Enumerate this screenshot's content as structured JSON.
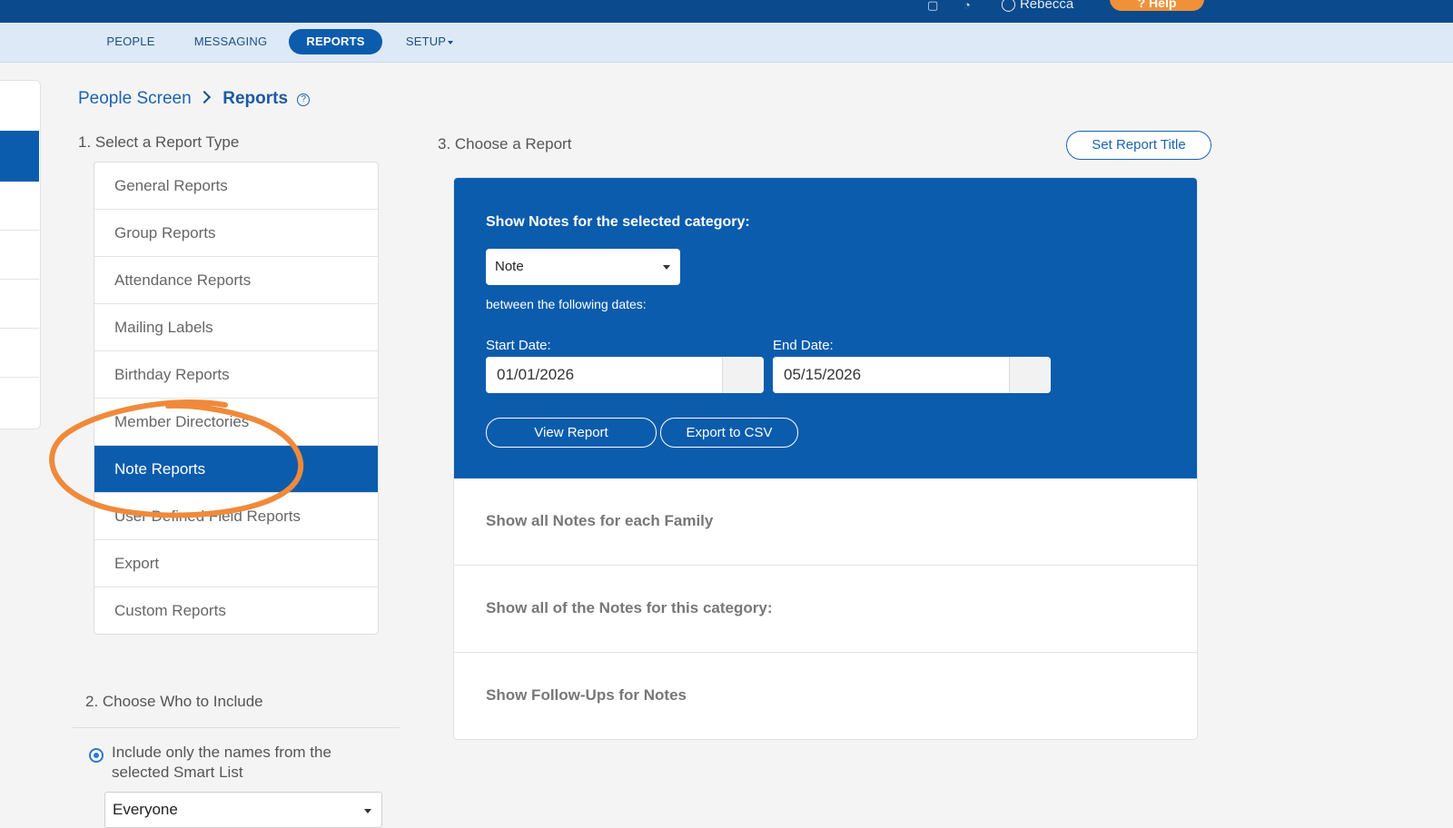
{
  "topbar": {
    "user_name": "Rebecca",
    "help_label": "Help"
  },
  "nav": {
    "items": [
      {
        "label": "PEOPLE"
      },
      {
        "label": "MESSAGING"
      },
      {
        "label": "REPORTS"
      },
      {
        "label": "SETUP"
      }
    ],
    "active": "REPORTS"
  },
  "breadcrumb": {
    "parent": "People Screen",
    "current": "Reports",
    "help": "?"
  },
  "section1": {
    "heading": "1. Select a Report Type",
    "items": [
      {
        "label": "General Reports"
      },
      {
        "label": "Group Reports"
      },
      {
        "label": "Attendance Reports"
      },
      {
        "label": "Mailing Labels"
      },
      {
        "label": "Birthday Reports"
      },
      {
        "label": "Member Directories"
      },
      {
        "label": "Note Reports"
      },
      {
        "label": "User Defined Field Reports"
      },
      {
        "label": "Export"
      },
      {
        "label": "Custom Reports"
      }
    ],
    "selected": "Note Reports"
  },
  "section3": {
    "heading": "3. Choose a Report",
    "set_title_label": "Set Report Title",
    "active_report": {
      "title": "Show Notes for the selected category:",
      "category_value": "Note",
      "between_text": "between the following dates:",
      "start_label": "Start Date:",
      "start_value": "01/01/2026",
      "end_label": "End Date:",
      "end_value": "05/15/2026",
      "view_label": "View Report",
      "export_label": "Export to CSV"
    },
    "options": [
      {
        "label": "Show all Notes for each Family"
      },
      {
        "label": "Show all of the Notes for this category:"
      },
      {
        "label": "Show Follow-Ups for Notes"
      }
    ]
  },
  "section2": {
    "heading": "2. Choose Who to Include",
    "radio_label": "Include only the names from the selected Smart List",
    "smart_list_value": "Everyone"
  },
  "colors": {
    "primary": "#0b5cad",
    "topbar": "#0b4a8c",
    "accent_orange": "#f0913a",
    "nav_bg": "#dde9f6"
  }
}
